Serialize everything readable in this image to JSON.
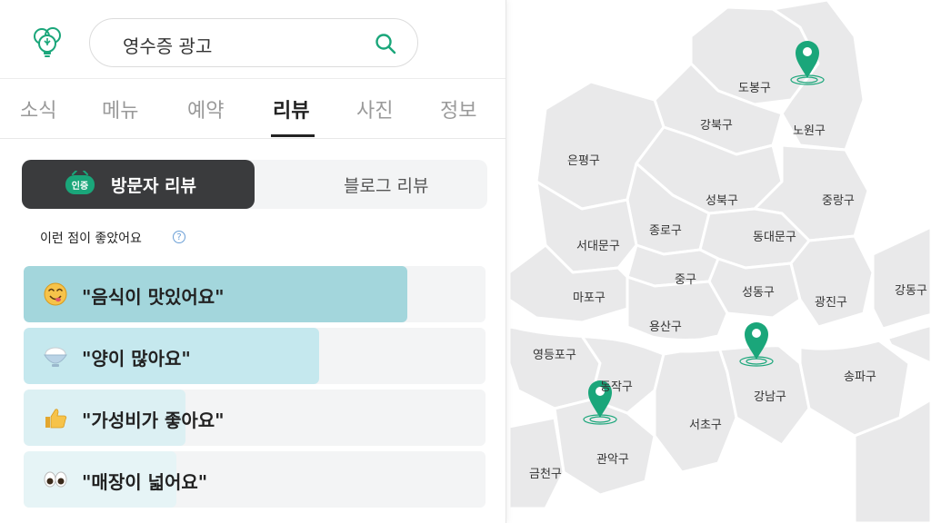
{
  "search": {
    "query": "영수증 광고"
  },
  "tabs": [
    {
      "label": "소식"
    },
    {
      "label": "메뉴"
    },
    {
      "label": "예약"
    },
    {
      "label": "리뷰",
      "active": true
    },
    {
      "label": "사진"
    },
    {
      "label": "정보"
    }
  ],
  "review_type": {
    "visitor_label": "방문자 리뷰",
    "visitor_badge": "인증",
    "blog_label": "블로그 리뷰"
  },
  "likes": {
    "heading": "이런 점이 좋았어요",
    "help": "?",
    "items": [
      {
        "label": "\"음식이 맛있어요\"",
        "emoji": "yum-face-icon",
        "level": 0.83,
        "color": "#a3d6dc"
      },
      {
        "label": "\"양이 많아요\"",
        "emoji": "rice-bowl-icon",
        "level": 0.64,
        "color": "#c5e8ee"
      },
      {
        "label": "\"가성비가 좋아요\"",
        "emoji": "thumbs-up-icon",
        "level": 0.35,
        "color": "#dcf0f3"
      },
      {
        "label": "\"매장이 넓어요\"",
        "emoji": "eyes-icon",
        "level": 0.33,
        "color": "#e6f4f6"
      }
    ]
  },
  "map": {
    "districts": [
      "도봉구",
      "강북구",
      "노원구",
      "은평구",
      "성북구",
      "중랑구",
      "종로구",
      "서대문구",
      "동대문구",
      "중구",
      "성동구",
      "광진구",
      "강동구",
      "마포구",
      "용산구",
      "영등포구",
      "동작구",
      "강남구",
      "송파구",
      "서초구",
      "관악구",
      "금천구"
    ],
    "pin_color": "#1aa67a"
  }
}
